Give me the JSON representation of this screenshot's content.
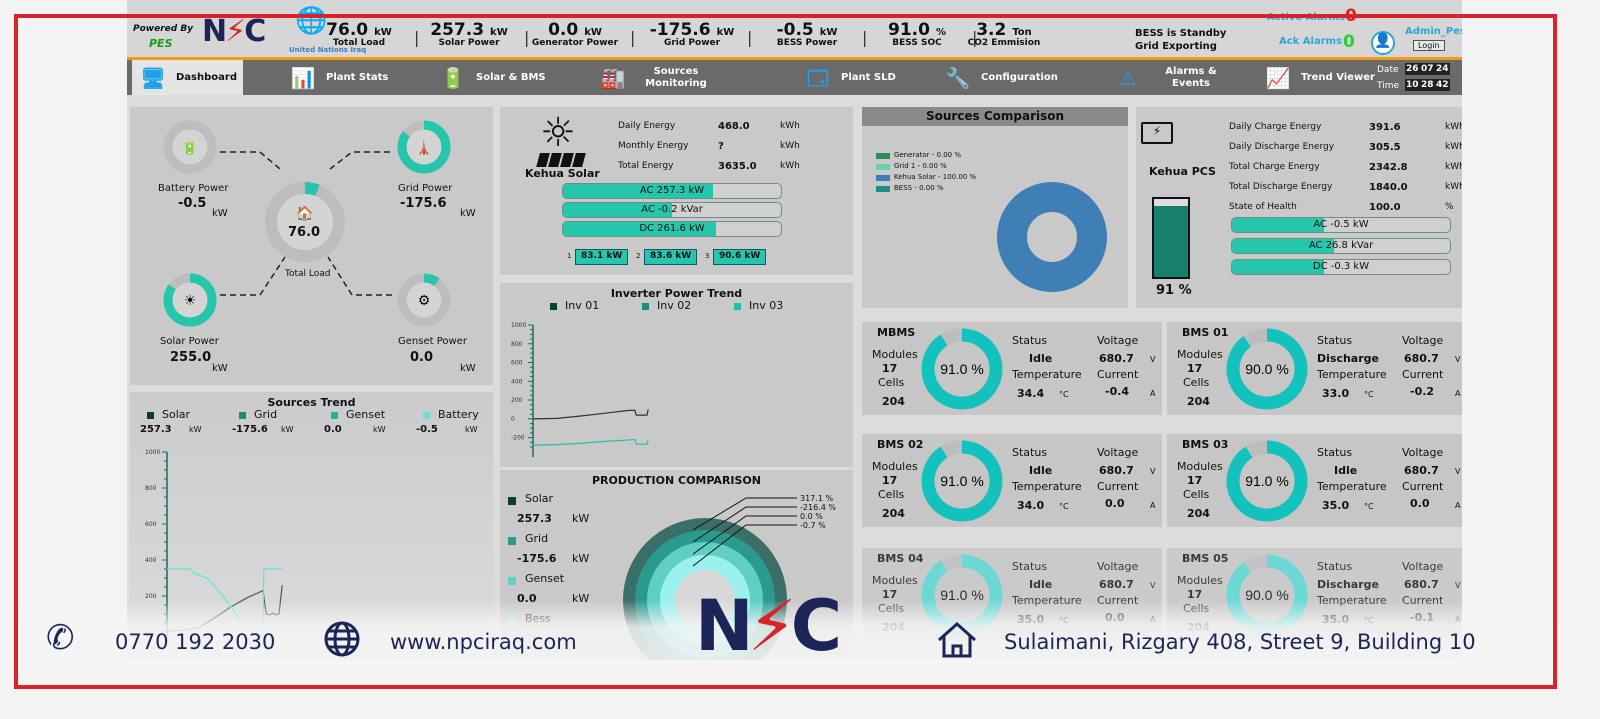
{
  "header": {
    "powered_by": "Powered By",
    "pes": "PES",
    "logo_text": "NPC",
    "un_text": "United Nations Iraq",
    "kpis": [
      {
        "value": "76.0",
        "unit": "kW",
        "label": "Total Load"
      },
      {
        "value": "257.3",
        "unit": "kW",
        "label": "Solar Power"
      },
      {
        "value": "0.0",
        "unit": "kW",
        "label": "Generator Power"
      },
      {
        "value": "-175.6",
        "unit": "kW",
        "label": "Grid Power"
      },
      {
        "value": "-0.5",
        "unit": "kW",
        "label": "BESS Power"
      },
      {
        "value": "91.0",
        "unit": "%",
        "label": "BESS SOC"
      },
      {
        "value": "3.2",
        "unit": "Ton",
        "label": "CO2 Emmision"
      }
    ],
    "status_line1": "BESS is Standby",
    "status_line2": "Grid Exporting",
    "active_alarms_label": "Active Alarms",
    "active_alarms_value": "0",
    "ack_alarms_label": "Ack Alarms",
    "ack_alarms_value": "0",
    "user": "Admin_Pes",
    "login": "Login"
  },
  "nav": {
    "items": [
      {
        "label": "Dashboard",
        "icon": "dashboard-monitor-icon",
        "active": true
      },
      {
        "label": "Plant Stats",
        "icon": "bar-chart-icon"
      },
      {
        "label": "Solar & BMS",
        "icon": "solar-bms-icon"
      },
      {
        "label": "Sources Monitoring",
        "icon": "sources-icon"
      },
      {
        "label": "Plant SLD",
        "icon": "sld-icon"
      },
      {
        "label": "Configuration",
        "icon": "wrench-gear-icon"
      },
      {
        "label": "Alarms & Events",
        "icon": "warning-icon"
      },
      {
        "label": "Trend Viewer",
        "icon": "trend-magnifier-icon"
      }
    ],
    "date_label": "Date",
    "date": [
      "26",
      "07",
      "24"
    ],
    "time_label": "Time",
    "time": [
      "10",
      "28",
      "42"
    ]
  },
  "flow": {
    "battery": {
      "label": "Battery Power",
      "value": "-0.5",
      "unit": "kW"
    },
    "grid": {
      "label": "Grid Power",
      "value": "-175.6",
      "unit": "kW"
    },
    "load": {
      "label": "Total Load",
      "value": "76.0"
    },
    "solar": {
      "label": "Solar Power",
      "value": "255.0",
      "unit": "kW"
    },
    "genset": {
      "label": "Genset Power",
      "value": "0.0",
      "unit": "kW"
    }
  },
  "kehua_solar": {
    "name": "Kehua Solar",
    "rows": [
      {
        "label": "Daily Energy",
        "value": "468.0",
        "unit": "kWh"
      },
      {
        "label": "Monthly Energy",
        "value": "?",
        "unit": "kWh"
      },
      {
        "label": "Total Energy",
        "value": "3635.0",
        "unit": "kWh"
      }
    ],
    "bars": [
      {
        "label": "AC   257.3  kW",
        "fill": 0.69
      },
      {
        "label": "AC   -0.2  kVar",
        "fill": 0.5
      },
      {
        "label": "DC   261.6 kW",
        "fill": 0.7
      }
    ],
    "inverters": [
      {
        "n": "1",
        "value": "83.1 kW"
      },
      {
        "n": "2",
        "value": "83.6 kW"
      },
      {
        "n": "3",
        "value": "90.6 kW"
      }
    ]
  },
  "sources_comparison": {
    "title": "Sources Comparison",
    "legend": [
      {
        "label": "Generator - 0.00 %",
        "color": "#2e8b57"
      },
      {
        "label": "Grid 1 - 0.00 %",
        "color": "#66d3a8"
      },
      {
        "label": "Kehua Solar - 100.00 %",
        "color": "#3f7fb5"
      },
      {
        "label": "BESS - 0.00 %",
        "color": "#1a8f8a"
      }
    ]
  },
  "pcs": {
    "name": "Kehua PCS",
    "soc_label": "91 %",
    "soc": 0.91,
    "rows": [
      {
        "label": "Daily Charge Energy",
        "value": "391.6",
        "unit": "kWh"
      },
      {
        "label": "Daily Discharge Energy",
        "value": "305.5",
        "unit": "kWh"
      },
      {
        "label": "Total Charge Energy",
        "value": "2342.8",
        "unit": "kWh"
      },
      {
        "label": "Total Discharge Energy",
        "value": "1840.0",
        "unit": "kWh"
      },
      {
        "label": "State of Health",
        "value": "100.0",
        "unit": "%"
      }
    ],
    "bars": [
      {
        "label": "AC      -0.5 kW",
        "fill": 0.42
      },
      {
        "label": "AC     26.8 kVar",
        "fill": 0.47
      },
      {
        "label": "DC      -0.3 kW",
        "fill": 0.42
      }
    ]
  },
  "bms": [
    {
      "name": "MBMS",
      "soc": 91.0,
      "soc_label": "91.0 %",
      "modules": "17",
      "cells": "204",
      "status": "Idle",
      "voltage": "680.7",
      "temperature": "34.4",
      "current": "-0.4"
    },
    {
      "name": "BMS 01",
      "soc": 90.0,
      "soc_label": "90.0 %",
      "modules": "17",
      "cells": "204",
      "status": "Discharge",
      "voltage": "680.7",
      "temperature": "33.0",
      "current": "-0.2"
    },
    {
      "name": "BMS 02",
      "soc": 91.0,
      "soc_label": "91.0 %",
      "modules": "17",
      "cells": "204",
      "status": "Idle",
      "voltage": "680.7",
      "temperature": "34.0",
      "current": "0.0"
    },
    {
      "name": "BMS 03",
      "soc": 91.0,
      "soc_label": "91.0 %",
      "modules": "17",
      "cells": "204",
      "status": "Idle",
      "voltage": "680.7",
      "temperature": "35.0",
      "current": "0.0"
    },
    {
      "name": "BMS 04",
      "soc": 91.0,
      "soc_label": "91.0 %",
      "modules": "17",
      "cells": "204",
      "status": "Idle",
      "voltage": "680.7",
      "temperature": "35.0",
      "current": "0.0"
    },
    {
      "name": "BMS 05",
      "soc": 90.0,
      "soc_label": "90.0 %",
      "modules": "17",
      "cells": "204",
      "status": "Discharge",
      "voltage": "680.7",
      "temperature": "35.0",
      "current": "-0.1"
    }
  ],
  "bms_labels": {
    "modules": "Modules",
    "cells": "Cells",
    "status": "Status",
    "voltage": "Voltage",
    "temperature": "Temperature",
    "current": "Current",
    "v": "V",
    "c": "°C",
    "a": "A"
  },
  "sources_trend": {
    "title": "Sources Trend",
    "legend": [
      {
        "name": "Solar",
        "value": "257.3",
        "unit": "kW",
        "color": "#0e3b33"
      },
      {
        "name": "Grid",
        "value": "-175.6",
        "unit": "kW",
        "color": "#1d8c80"
      },
      {
        "name": "Genset",
        "value": "0.0",
        "unit": "kW",
        "color": "#20b2a6"
      },
      {
        "name": "Battery",
        "value": "-0.5",
        "unit": "kW",
        "color": "#5fe3e0"
      }
    ]
  },
  "inverter_trend": {
    "title": "Inverter Power Trend",
    "legend": [
      {
        "name": "Inv 01",
        "color": "#0e3b33"
      },
      {
        "name": "Inv 02",
        "color": "#1d8c80"
      },
      {
        "name": "Inv 03",
        "color": "#20c0b0"
      }
    ]
  },
  "production": {
    "title": "PRODUCTION COMPARISON",
    "items": [
      {
        "name": "Solar",
        "value": "257.3",
        "unit": "kW",
        "pct": "317.1 %",
        "color": "#0e3b33"
      },
      {
        "name": "Grid",
        "value": "-175.6",
        "unit": "kW",
        "pct": "-216.4 %",
        "color": "#2a9a8e"
      },
      {
        "name": "Genset",
        "value": "0.0",
        "unit": "kW",
        "pct": "0.0 %",
        "color": "#5fcfc4"
      },
      {
        "name": "Bess",
        "pct": "-0.7 %",
        "color": "#9af0ec"
      }
    ]
  },
  "chart_data": [
    {
      "type": "line",
      "title": "Sources Trend",
      "ylim": [
        0,
        1000
      ],
      "yticks": [
        "1000",
        "800",
        "600",
        "400",
        "200",
        "0"
      ],
      "series": [
        {
          "name": "Solar",
          "x": [
            0,
            10,
            20,
            30,
            40,
            50,
            60,
            62,
            64,
            66,
            68,
            70,
            72
          ],
          "values": [
            5,
            10,
            25,
            80,
            140,
            190,
            230,
            100,
            95,
            105,
            95,
            100,
            260
          ]
        },
        {
          "name": "Battery",
          "x": [
            0,
            15,
            16,
            25,
            35,
            45,
            55,
            60,
            60.5,
            72
          ],
          "values": [
            350,
            350,
            330,
            300,
            200,
            80,
            -20,
            -60,
            350,
            350
          ]
        }
      ]
    },
    {
      "type": "line",
      "title": "Inverter Power Trend",
      "ylim": [
        -300,
        1000
      ],
      "yticks": [
        "1000",
        "800",
        "600",
        "400",
        "200",
        "0",
        "-200"
      ],
      "series": [
        {
          "name": "Inv 01",
          "x": [
            0,
            20,
            40,
            60,
            80,
            85,
            86,
            95,
            96
          ],
          "values": [
            0,
            5,
            30,
            60,
            90,
            90,
            40,
            40,
            100
          ]
        },
        {
          "name": "Inv 03",
          "x": [
            0,
            20,
            40,
            60,
            80,
            85,
            86,
            95,
            96
          ],
          "values": [
            -280,
            -275,
            -260,
            -240,
            -225,
            -220,
            -270,
            -270,
            -220
          ]
        }
      ]
    }
  ],
  "footer": {
    "phone": "0770 192 2030",
    "website": "www.npciraq.com",
    "logo": "NPC",
    "address": "Sulaimani, Rizgary 408, Street 9, Building 10"
  },
  "colors": {
    "accent": "#25c6ab",
    "frame": "#d9232b",
    "brand_navy": "#1c2558",
    "nav": "#6a6a6a",
    "header_rule": "#f39c12"
  }
}
